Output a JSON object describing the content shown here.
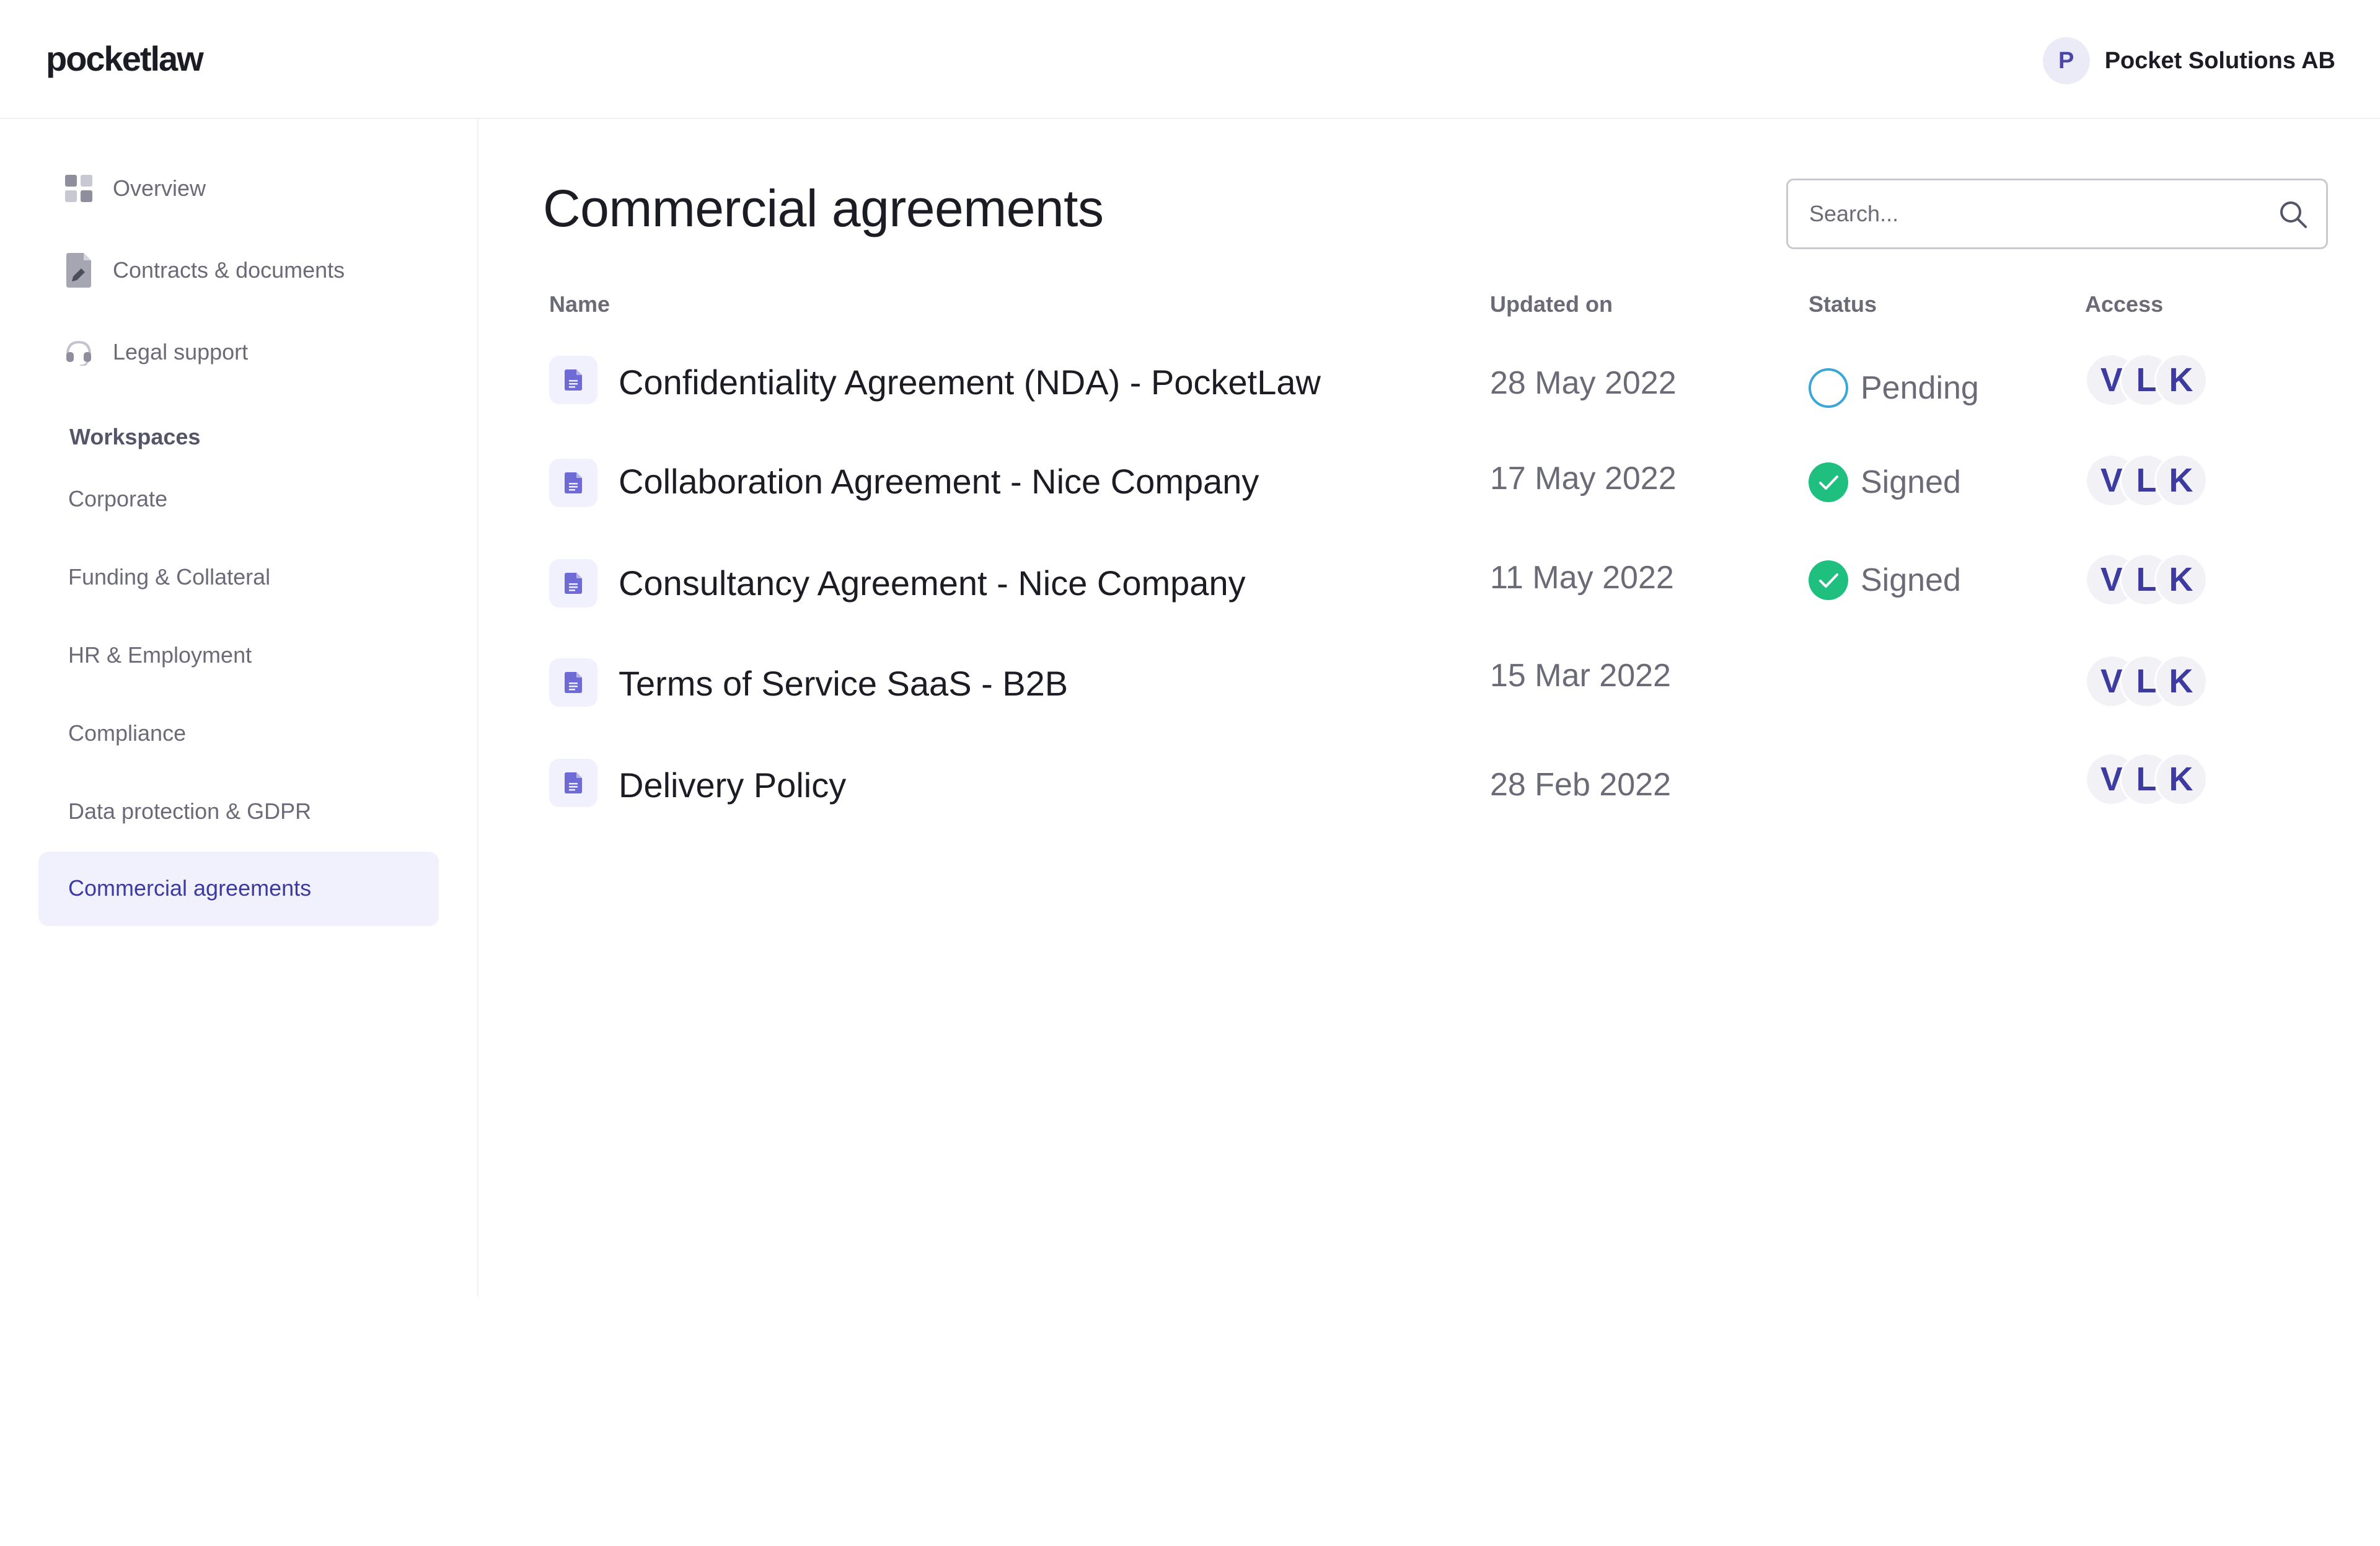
{
  "header": {
    "logo": "pocketlaw",
    "account_initial": "P",
    "account_name": "Pocket Solutions AB"
  },
  "sidebar": {
    "nav": [
      {
        "label": "Overview",
        "icon": "grid-icon"
      },
      {
        "label": "Contracts & documents",
        "icon": "document-edit-icon"
      },
      {
        "label": "Legal support",
        "icon": "headset-icon"
      }
    ],
    "workspaces_title": "Workspaces",
    "workspaces": [
      "Corporate",
      "Funding & Collateral",
      "HR & Employment",
      "Compliance",
      "Data protection & GDPR",
      "Commercial agreements"
    ],
    "active_workspace": "Commercial agreements"
  },
  "main": {
    "title": "Commercial agreements",
    "search_placeholder": "Search...",
    "columns": {
      "name": "Name",
      "updated": "Updated on",
      "status": "Status",
      "access": "Access"
    },
    "rows": [
      {
        "name": "Confidentiality Agreement (NDA) - PocketLaw",
        "updated": "28 May 2022",
        "status": "Pending",
        "access": [
          "V",
          "L",
          "K"
        ]
      },
      {
        "name": "Collaboration Agreement - Nice Company",
        "updated": "17 May 2022",
        "status": "Signed",
        "access": [
          "V",
          "L",
          "K"
        ]
      },
      {
        "name": "Consultancy Agreement - Nice Company",
        "updated": "11 May 2022",
        "status": "Signed",
        "access": [
          "V",
          "L",
          "K"
        ]
      },
      {
        "name": "Terms of Service SaaS - B2B",
        "updated": "15 Mar 2022",
        "status": "",
        "access": [
          "V",
          "L",
          "K"
        ]
      },
      {
        "name": "Delivery Policy",
        "updated": "28 Feb 2022",
        "status": "",
        "access": [
          "V",
          "L",
          "K"
        ]
      }
    ]
  },
  "colors": {
    "accent": "#3d3aa0",
    "active_bg": "#f1f1fd",
    "signed": "#1fbf7f",
    "pending": "#3aa7d6"
  }
}
